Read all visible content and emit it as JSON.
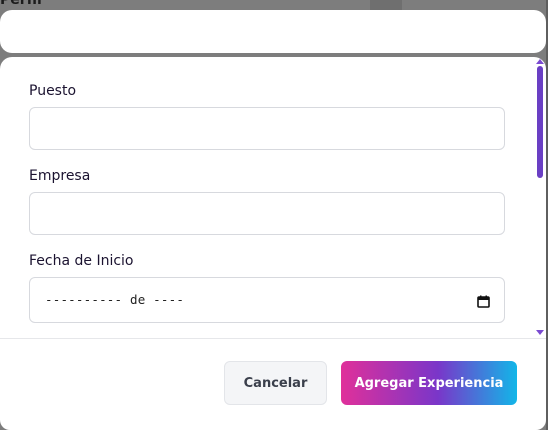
{
  "backdrop": {
    "partial_text": "Perfil"
  },
  "form": {
    "fields": [
      {
        "label": "Puesto",
        "value": "",
        "placeholder": ""
      },
      {
        "label": "Empresa",
        "value": "",
        "placeholder": ""
      },
      {
        "label": "Fecha de Inicio",
        "value": "---------- de ----"
      }
    ]
  },
  "footer": {
    "cancel_label": "Cancelar",
    "submit_label": "Agregar Experiencia"
  },
  "icons": {
    "date_picker": "calendar-icon"
  },
  "colors": {
    "scrollbar": "#6a3fc4",
    "button_gradient_start": "#e0309a",
    "button_gradient_mid": "#7a36c9",
    "button_gradient_end": "#12b6e8"
  }
}
